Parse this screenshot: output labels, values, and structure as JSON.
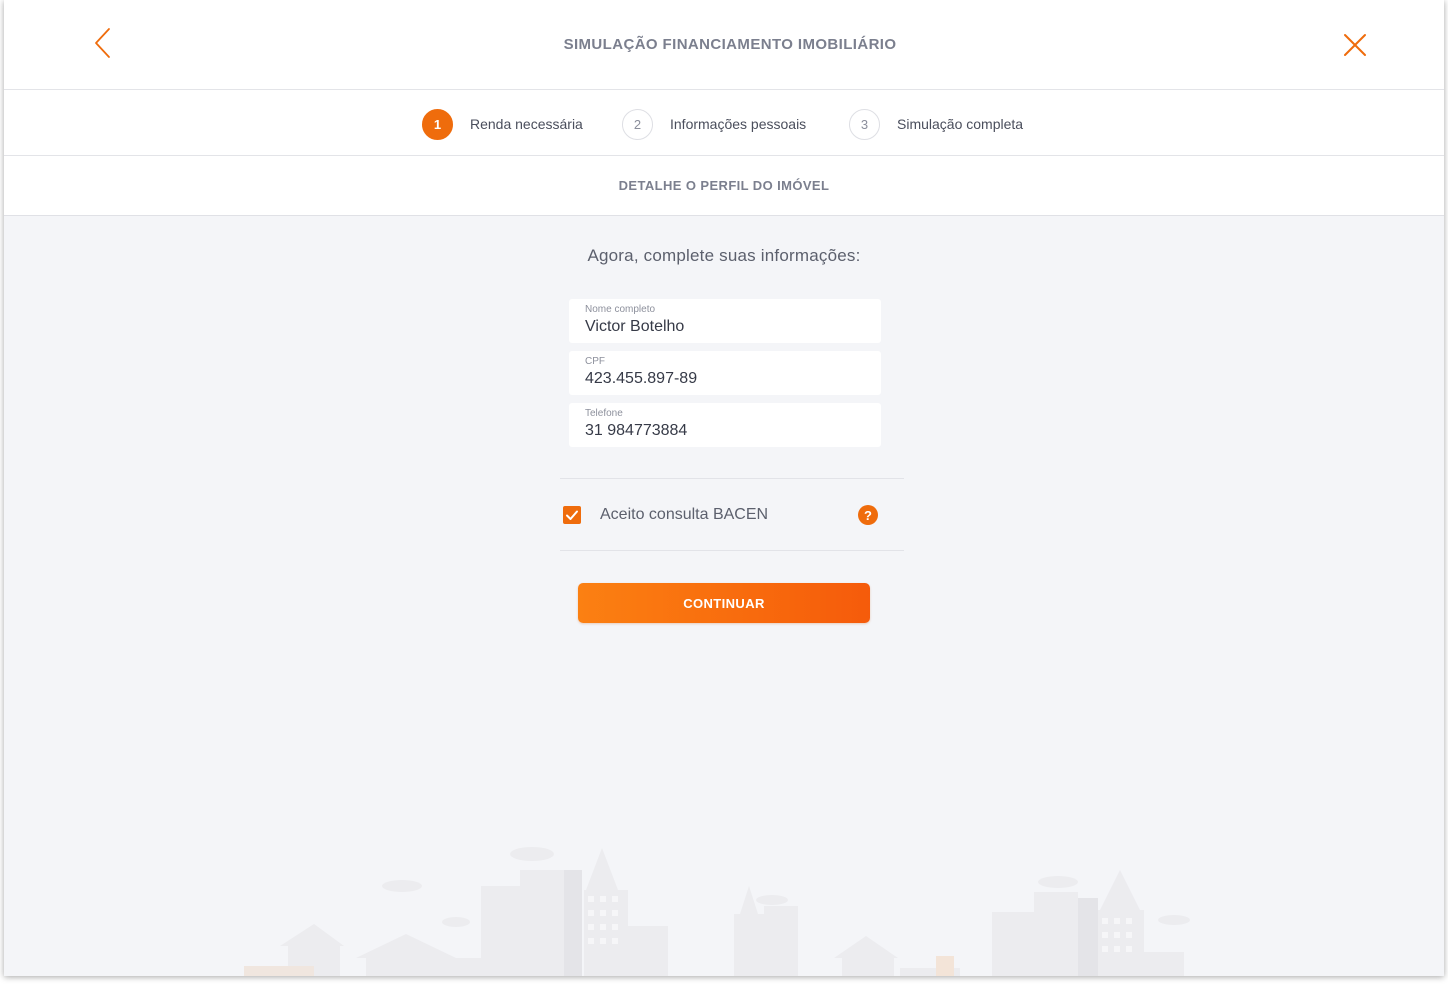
{
  "header": {
    "title": "SIMULAÇÃO FINANCIAMENTO IMOBILIÁRIO",
    "back_icon": "chevron-left-icon",
    "close_icon": "close-icon"
  },
  "stepper": {
    "steps": [
      {
        "number": "1",
        "label": "Renda necessária",
        "active": true
      },
      {
        "number": "2",
        "label": "Informações pessoais",
        "active": false
      },
      {
        "number": "3",
        "label": "Simulação completa",
        "active": false
      }
    ]
  },
  "section": {
    "title": "DETALHE O PERFIL DO IMÓVEL"
  },
  "form": {
    "intro": "Agora, complete suas informações:",
    "fields": [
      {
        "label": "Nome completo",
        "value": "Victor Botelho"
      },
      {
        "label": "CPF",
        "value": "423.455.897-89"
      },
      {
        "label": "Telefone",
        "value": "31 984773884"
      }
    ],
    "consent": {
      "label": "Aceito consulta BACEN",
      "checked": true,
      "help_symbol": "?"
    },
    "continue_label": "CONTINUAR"
  },
  "colors": {
    "accent": "#ef6c0c",
    "background": "#f4f5f8",
    "text": "#363a47"
  }
}
